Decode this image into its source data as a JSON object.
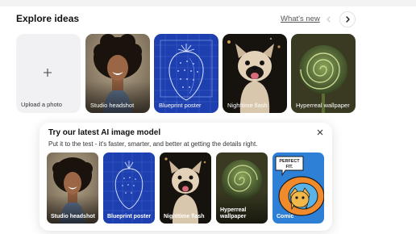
{
  "header": {
    "title": "Explore ideas",
    "whats_new": "What's new"
  },
  "upload": {
    "label": "Upload a photo"
  },
  "ideas": [
    {
      "label": "Studio headshot"
    },
    {
      "label": "Blueprint poster"
    },
    {
      "label": "Nighttime flash"
    },
    {
      "label": "Hyperreal wallpaper"
    }
  ],
  "modal": {
    "title": "Try our latest AI image model",
    "subtitle": "Put it to the test - it's faster, smarter, and better at getting the details right.",
    "cards": [
      {
        "label": "Studio headshot"
      },
      {
        "label": "Blueprint poster"
      },
      {
        "label": "Nighttime flash"
      },
      {
        "label": "Hyperreal wallpaper"
      },
      {
        "label": "Comic"
      }
    ],
    "comic_bubble": "PERFECT FIT."
  },
  "icons": {
    "prev": "chevron-left-icon",
    "next": "chevron-right-icon",
    "upload": "plus-icon",
    "close": "close-icon"
  },
  "colors": {
    "blueprint": "#1d3fb0",
    "comic_bg": "#2e7fd6"
  }
}
